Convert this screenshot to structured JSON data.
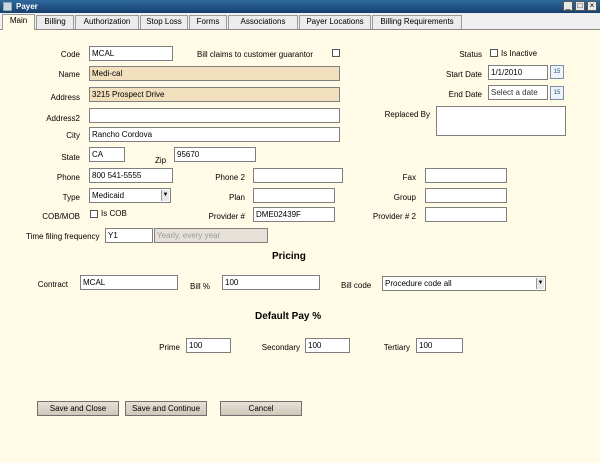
{
  "window": {
    "title": "Payer",
    "controls": [
      "_",
      "□",
      "×"
    ]
  },
  "tabs": [
    "Main",
    "Billing",
    "Authorization",
    "Stop Loss",
    "Forms",
    "Associations",
    "Payer Locations",
    "Billing Requirements"
  ],
  "form": {
    "code_label": "Code",
    "code_value": "MCAL",
    "bill_claims_label": "Bill claims to customer guarantor",
    "name_label": "Name",
    "name_value": "Medi-cal",
    "address_label": "Address",
    "address_value": "3215 Prospect Drive",
    "address2_label": "Address2",
    "address2_value": "",
    "city_label": "City",
    "city_value": "Rancho Cordova",
    "state_label": "State",
    "state_value": "CA",
    "zip_label": "Zip",
    "zip_value": "95670",
    "phone_label": "Phone",
    "phone_value": "800 541-5555",
    "phone2_label": "Phone 2",
    "phone2_value": "",
    "fax_label": "Fax",
    "fax_value": "",
    "type_label": "Type",
    "type_value": "Medicaid",
    "plan_label": "Plan",
    "plan_value": "",
    "group_label": "Group",
    "group_value": "",
    "cobmob_label": "COB/MOB",
    "is_cob_label": "Is COB",
    "provider_label": "Provider #",
    "provider_value": "DME02439F",
    "provider2_label": "Provider # 2",
    "provider2_value": "",
    "timefiling_label": "Time filing frequency",
    "timefiling_code": "Y1",
    "timefiling_desc": "Yearly, every year",
    "status_label": "Status",
    "is_inactive_label": "Is Inactive",
    "start_date_label": "Start Date",
    "start_date_value": "1/1/2010",
    "end_date_label": "End Date",
    "end_date_placeholder": "Select a date",
    "replaced_by_label": "Replaced By",
    "replaced_by_value": "",
    "calendar_glyph": "15"
  },
  "pricing": {
    "heading": "Pricing",
    "contract_label": "Contract",
    "contract_value": "MCAL",
    "billpct_label": "Bill %",
    "billpct_value": "100",
    "billcode_label": "Bill code",
    "billcode_value": "Procedure code all"
  },
  "default_pay": {
    "heading": "Default Pay %",
    "prime_label": "Prime",
    "prime_value": "100",
    "secondary_label": "Secondary",
    "secondary_value": "100",
    "tertiary_label": "Tertiary",
    "tertiary_value": "100"
  },
  "buttons": {
    "save_close": "Save and Close",
    "save_continue": "Save and Continue",
    "cancel": "Cancel"
  },
  "dropdown_arrow": "▼"
}
